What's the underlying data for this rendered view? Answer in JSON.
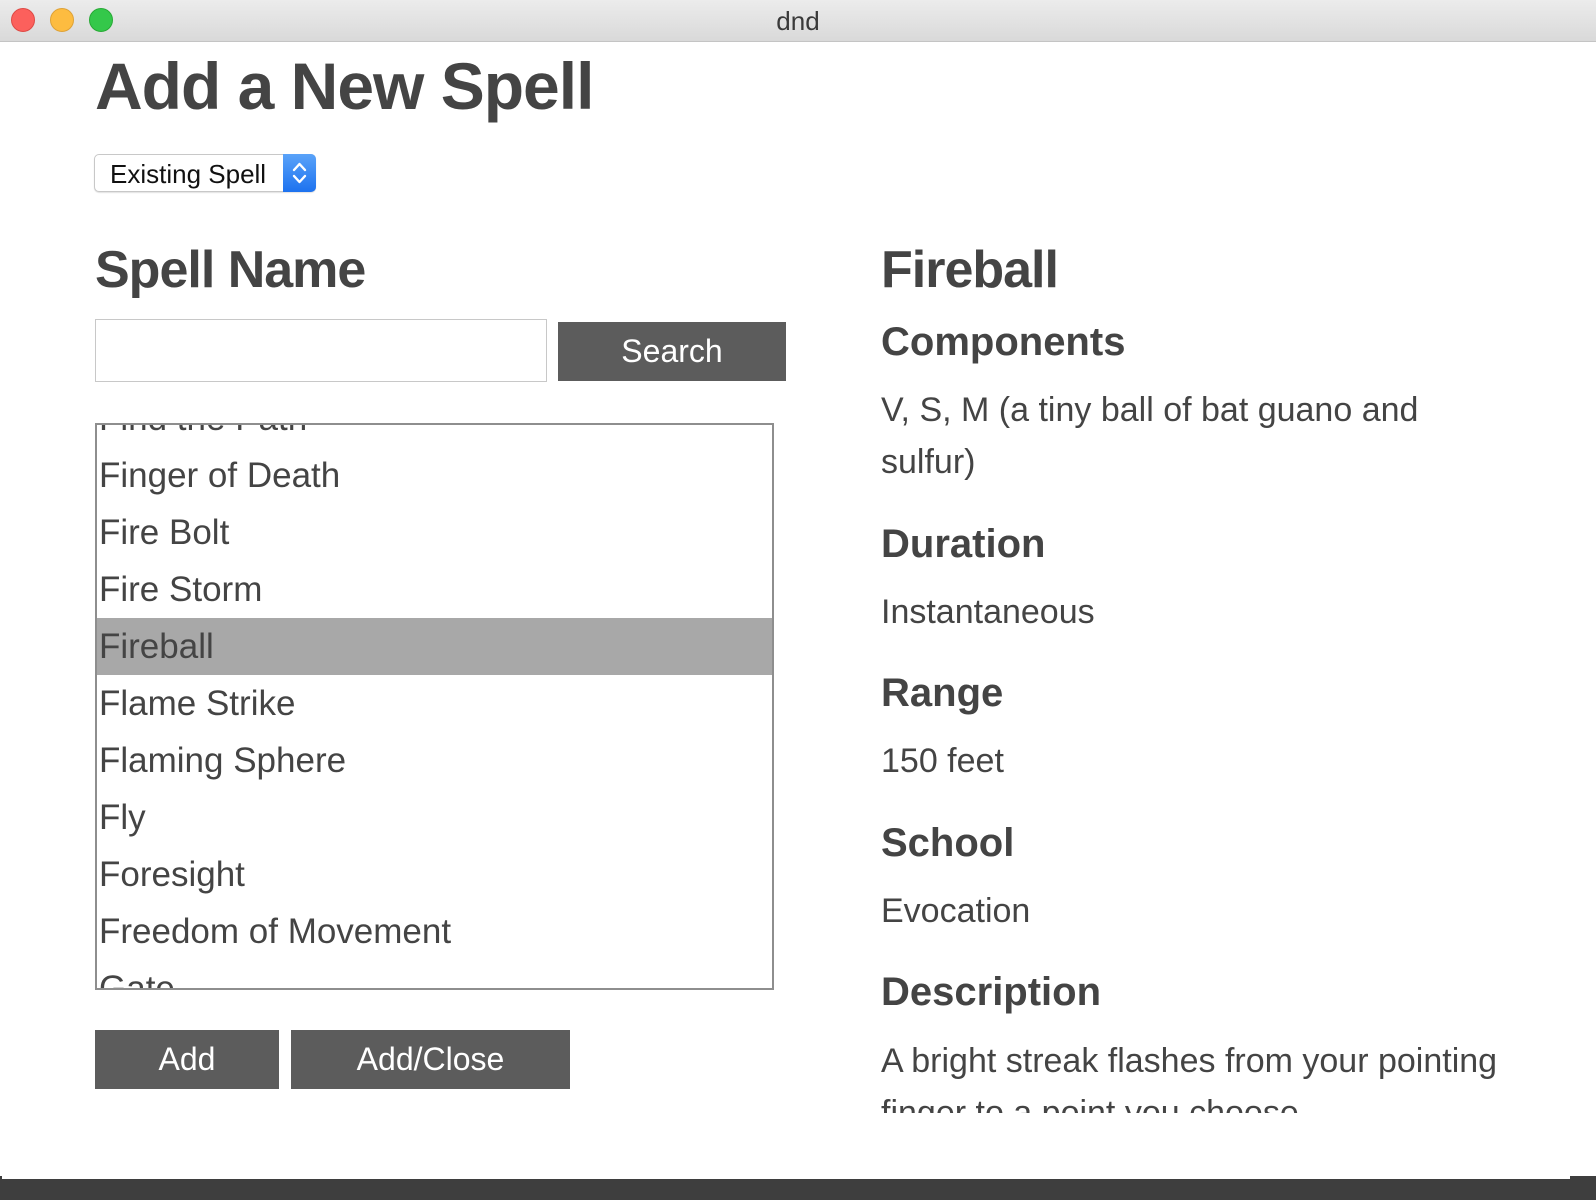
{
  "window": {
    "title": "dnd"
  },
  "page": {
    "title": "Add a New Spell",
    "source_select": {
      "value": "Existing Spell"
    }
  },
  "search": {
    "heading": "Spell Name",
    "input_value": "",
    "button_label": "Search"
  },
  "spell_list": {
    "items": [
      {
        "label": "Find the Path"
      },
      {
        "label": "Finger of Death"
      },
      {
        "label": "Fire Bolt"
      },
      {
        "label": "Fire Storm"
      },
      {
        "label": "Fireball",
        "selected": true
      },
      {
        "label": "Flame Strike"
      },
      {
        "label": "Flaming Sphere"
      },
      {
        "label": "Fly"
      },
      {
        "label": "Foresight"
      },
      {
        "label": "Freedom of Movement"
      },
      {
        "label": "Gate"
      }
    ]
  },
  "actions": {
    "add_label": "Add",
    "add_close_label": "Add/Close"
  },
  "detail": {
    "name": "Fireball",
    "components_heading": "Components",
    "components": "V, S, M (a tiny ball of bat guano and sulfur)",
    "duration_heading": "Duration",
    "duration": "Instantaneous",
    "range_heading": "Range",
    "range": "150 feet",
    "school_heading": "School",
    "school": "Evocation",
    "description_heading": "Description",
    "description": "A bright streak flashes from your pointing finger to a point you choose"
  },
  "colors": {
    "button_bg": "#5c5c5c",
    "selected_row": "#a8a8a8",
    "text": "#444444",
    "select_accent": "#1d72ef"
  }
}
